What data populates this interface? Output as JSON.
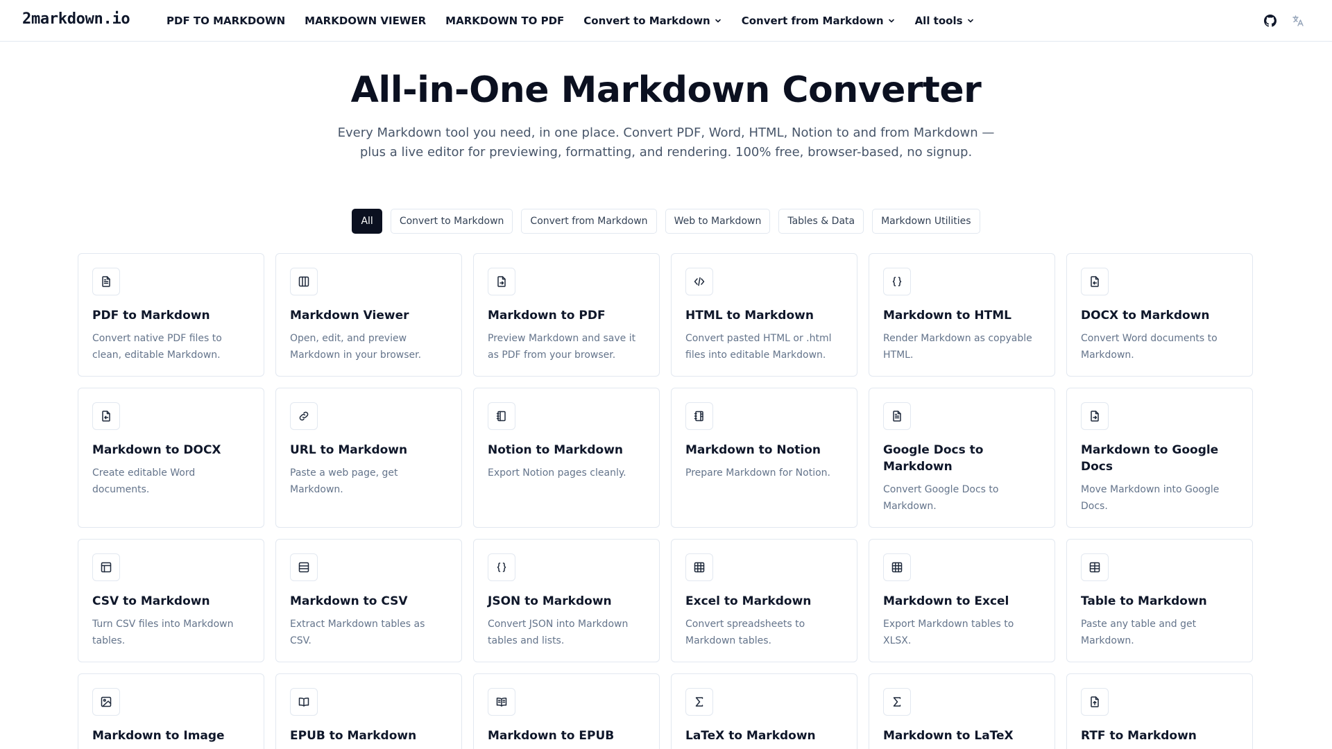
{
  "brand": "2markdown.io",
  "nav": {
    "links": [
      "PDF TO MARKDOWN",
      "MARKDOWN VIEWER",
      "MARKDOWN TO PDF"
    ],
    "dropdowns": [
      "Convert to Markdown",
      "Convert from Markdown",
      "All tools"
    ],
    "right_icons": [
      "github-icon",
      "translate-icon"
    ]
  },
  "hero": {
    "title": "All-in-One Markdown Converter",
    "subtitle": "Every Markdown tool you need, in one place. Convert PDF, Word, HTML, Notion to and from Markdown — plus a live editor for previewing, formatting, and rendering. 100% free, browser-based, no signup."
  },
  "filters": {
    "active": "All",
    "items": [
      "All",
      "Convert to Markdown",
      "Convert from Markdown",
      "Web to Markdown",
      "Tables & Data",
      "Markdown Utilities"
    ]
  },
  "tools": [
    {
      "icon": "file-text-icon",
      "title": "PDF to Markdown",
      "desc": "Convert native PDF files to clean, editable Markdown."
    },
    {
      "icon": "columns-icon",
      "title": "Markdown Viewer",
      "desc": "Open, edit, and preview Markdown in your browser."
    },
    {
      "icon": "file-export-icon",
      "title": "Markdown to PDF",
      "desc": "Preview Markdown and save it as PDF from your browser."
    },
    {
      "icon": "code-icon",
      "title": "HTML to Markdown",
      "desc": "Convert pasted HTML or .html files into editable Markdown."
    },
    {
      "icon": "braces-icon",
      "title": "Markdown to HTML",
      "desc": "Render Markdown as copyable HTML."
    },
    {
      "icon": "file-import-icon",
      "title": "DOCX to Markdown",
      "desc": "Convert Word documents to Markdown."
    },
    {
      "icon": "file-import-icon",
      "title": "Markdown to DOCX",
      "desc": "Create editable Word documents."
    },
    {
      "icon": "link-icon",
      "title": "URL to Markdown",
      "desc": "Paste a web page, get Markdown."
    },
    {
      "icon": "notebook-icon",
      "title": "Notion to Markdown",
      "desc": "Export Notion pages cleanly."
    },
    {
      "icon": "notebook-tabs-icon",
      "title": "Markdown to Notion",
      "desc": "Prepare Markdown for Notion."
    },
    {
      "icon": "file-text-icon",
      "title": "Google Docs to Markdown",
      "desc": "Convert Google Docs to Markdown."
    },
    {
      "icon": "file-export-icon",
      "title": "Markdown to Google Docs",
      "desc": "Move Markdown into Google Docs."
    },
    {
      "icon": "table-layout-icon",
      "title": "CSV to Markdown",
      "desc": "Turn CSV files into Markdown tables."
    },
    {
      "icon": "table-rows-icon",
      "title": "Markdown to CSV",
      "desc": "Extract Markdown tables as CSV."
    },
    {
      "icon": "braces-icon",
      "title": "JSON to Markdown",
      "desc": "Convert JSON into Markdown tables and lists."
    },
    {
      "icon": "spreadsheet-icon",
      "title": "Excel to Markdown",
      "desc": "Convert spreadsheets to Markdown tables."
    },
    {
      "icon": "spreadsheet-icon",
      "title": "Markdown to Excel",
      "desc": "Export Markdown tables to XLSX."
    },
    {
      "icon": "table-icon",
      "title": "Table to Markdown",
      "desc": "Paste any table and get Markdown."
    },
    {
      "icon": "image-icon",
      "title": "Markdown to Image",
      "desc": ""
    },
    {
      "icon": "book-open-icon",
      "title": "EPUB to Markdown",
      "desc": ""
    },
    {
      "icon": "book-text-icon",
      "title": "Markdown to EPUB",
      "desc": ""
    },
    {
      "icon": "sigma-icon",
      "title": "LaTeX to Markdown",
      "desc": ""
    },
    {
      "icon": "sigma-icon",
      "title": "Markdown to LaTeX",
      "desc": ""
    },
    {
      "icon": "file-up-icon",
      "title": "RTF to Markdown",
      "desc": ""
    }
  ]
}
